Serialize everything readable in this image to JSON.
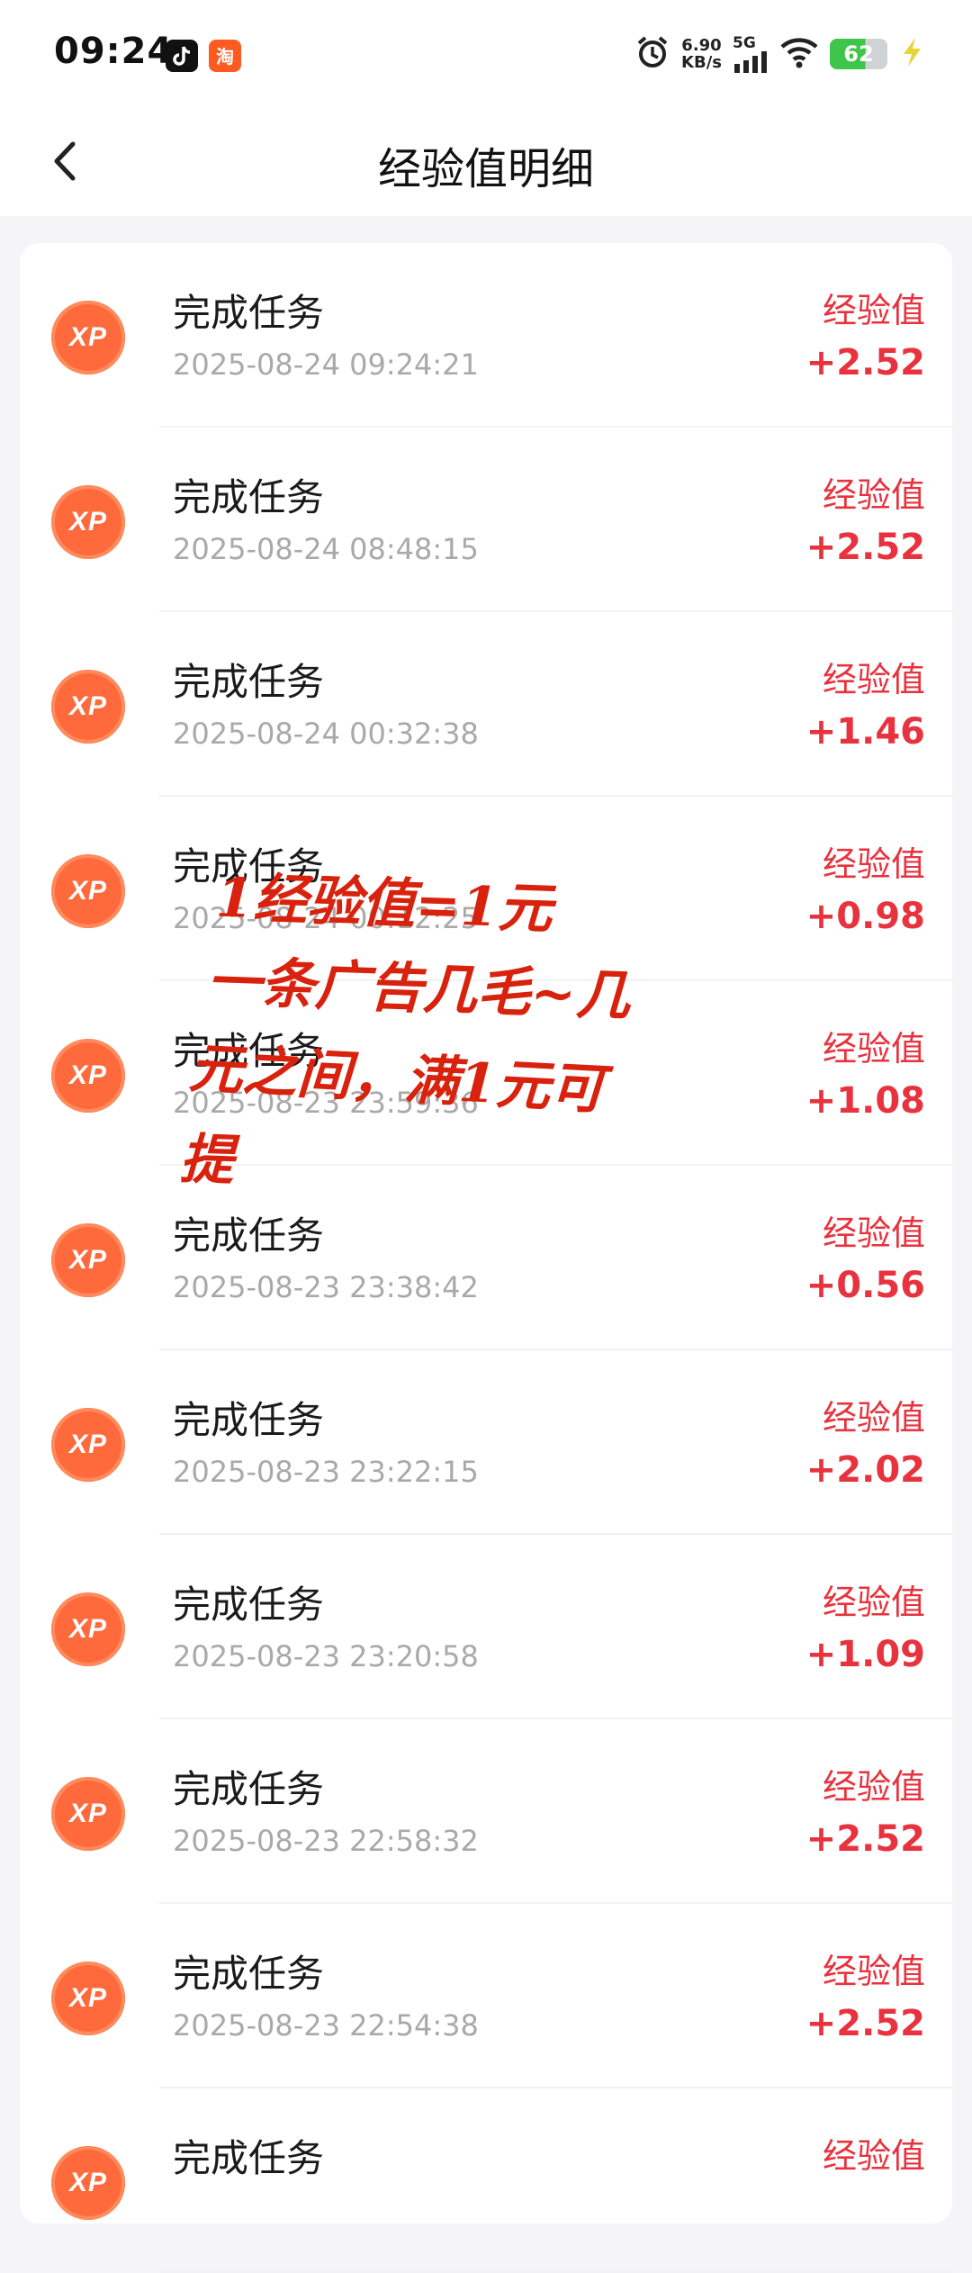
{
  "status_bar": {
    "time": "09:24",
    "net_speed_value": "6.90",
    "net_speed_unit": "KB/s",
    "network": "5G",
    "battery": "62",
    "app_icon_1": "tiktok-icon",
    "app_icon_2": "taobao-icon"
  },
  "header": {
    "title": "经验值明细"
  },
  "records": [
    {
      "title": "完成任务",
      "time": "2025-08-24 09:24:21",
      "label": "经验值",
      "value": "+2.52"
    },
    {
      "title": "完成任务",
      "time": "2025-08-24 08:48:15",
      "label": "经验值",
      "value": "+2.52"
    },
    {
      "title": "完成任务",
      "time": "2025-08-24 00:32:38",
      "label": "经验值",
      "value": "+1.46"
    },
    {
      "title": "完成任务",
      "time": "2025-08-24 00:12:25",
      "label": "经验值",
      "value": "+0.98"
    },
    {
      "title": "完成任务",
      "time": "2025-08-23 23:59:36",
      "label": "经验值",
      "value": "+1.08"
    },
    {
      "title": "完成任务",
      "time": "2025-08-23 23:38:42",
      "label": "经验值",
      "value": "+0.56"
    },
    {
      "title": "完成任务",
      "time": "2025-08-23 23:22:15",
      "label": "经验值",
      "value": "+2.02"
    },
    {
      "title": "完成任务",
      "time": "2025-08-23 23:20:58",
      "label": "经验值",
      "value": "+1.09"
    },
    {
      "title": "完成任务",
      "time": "2025-08-23 22:58:32",
      "label": "经验值",
      "value": "+2.52"
    },
    {
      "title": "完成任务",
      "time": "2025-08-23 22:54:38",
      "label": "经验值",
      "value": "+2.52"
    },
    {
      "title": "完成任务",
      "time": "",
      "label": "经验值",
      "value": ""
    }
  ],
  "badge_text": "XP",
  "annotation": {
    "line1": "1经验值=1元",
    "line2": "一条广告几毛~几",
    "line3": "元之间，满1元可",
    "line4": "提"
  },
  "colors": {
    "accent_red": "#e8323e",
    "badge_orange": "#ff6a3c",
    "handwriting": "#d8220d"
  }
}
